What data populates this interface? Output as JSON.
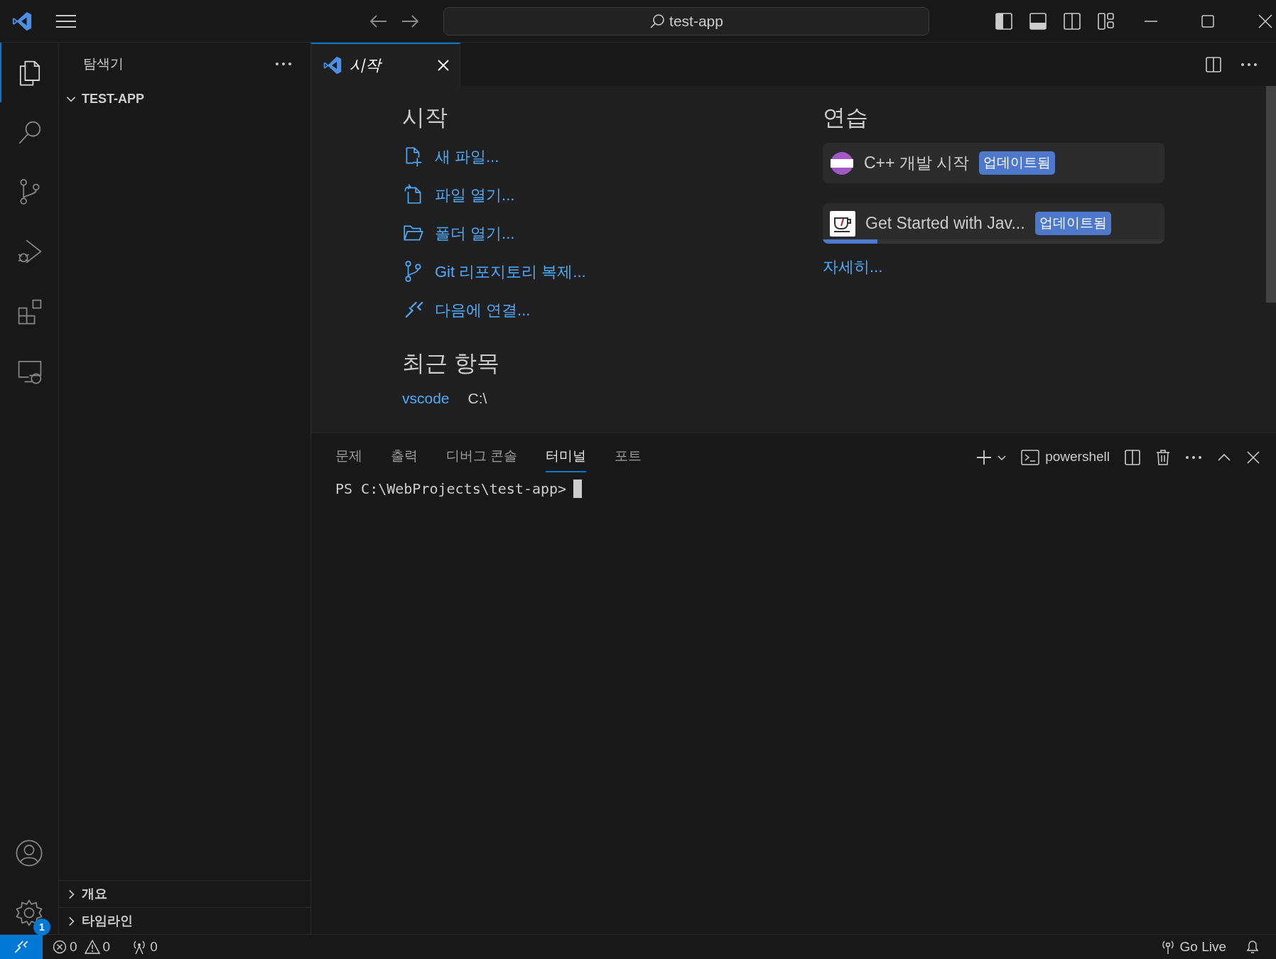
{
  "title_bar": {
    "search": "test-app"
  },
  "activity_bar": {
    "items": [
      {
        "kind": "explorer",
        "selected": true
      },
      {
        "kind": "search",
        "selected": false
      },
      {
        "kind": "source-control",
        "selected": false
      },
      {
        "kind": "run-debug",
        "selected": false
      },
      {
        "kind": "extensions",
        "selected": false
      },
      {
        "kind": "remote",
        "selected": false
      }
    ],
    "bottom": [
      {
        "kind": "account"
      },
      {
        "kind": "settings",
        "badge": "1"
      }
    ]
  },
  "sidebar": {
    "title": "탐색기",
    "folder": {
      "label": "TEST-APP",
      "expanded": true
    },
    "sections": [
      {
        "label": "개요",
        "expanded": false
      },
      {
        "label": "타임라인",
        "expanded": false
      }
    ]
  },
  "editor": {
    "tabs": [
      {
        "label": "시작",
        "selected": true
      }
    ],
    "start": {
      "heading": "시작",
      "items": [
        {
          "kind": "new-file",
          "label": "새 파일..."
        },
        {
          "kind": "open-file",
          "label": "파일 열기..."
        },
        {
          "kind": "open-folder",
          "label": "폴더 열기..."
        },
        {
          "kind": "git",
          "label": "Git 리포지토리 복제..."
        },
        {
          "kind": "remote",
          "label": "다음에 연결..."
        }
      ]
    },
    "recent": {
      "heading": "최근 항목",
      "items": [
        {
          "name": "vscode",
          "path": "C:\\"
        }
      ]
    },
    "walkthroughs": {
      "heading": "연습",
      "items": [
        {
          "kind": "cpp",
          "title": "C++ 개발 시작",
          "badge": "업데이트됨"
        },
        {
          "kind": "java",
          "title": "Get Started with Jav...",
          "badge": "업데이트됨",
          "level": 0.16
        }
      ],
      "more": "자세히..."
    }
  },
  "panel": {
    "tabs": [
      {
        "label": "문제",
        "selected": false
      },
      {
        "label": "출력",
        "selected": false
      },
      {
        "label": "디버그 콘솔",
        "selected": false
      },
      {
        "label": "터미널",
        "selected": true
      },
      {
        "label": "포트",
        "selected": false
      }
    ],
    "shell": "powershell",
    "prompt": "PS C:\\WebProjects\\test-app>"
  },
  "status_bar": {
    "errors": "0",
    "warnings": "0",
    "ports": "0",
    "go_live": "Go Live"
  }
}
